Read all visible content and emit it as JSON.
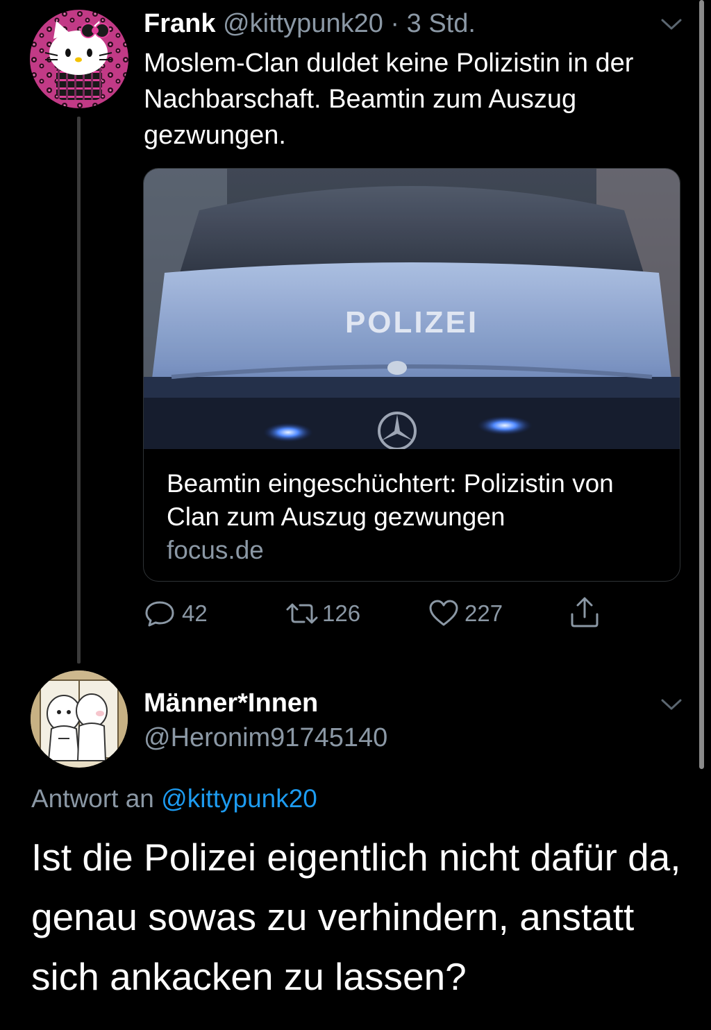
{
  "tweet": {
    "name": "Frank",
    "handle": "@kittypunk20",
    "separator": "·",
    "time": "3 Std.",
    "text": "Moslem-Clan duldet keine Polizistin in der Nachbarschaft. Beamtin zum Auszug gezwungen.",
    "avatar_icon": "hello-kitty-avatar",
    "card": {
      "image_text": "POLIZEI",
      "title": "Beamtin eingeschüchtert: Polizistin von Clan zum Auszug gezwungen",
      "domain": "focus.de"
    },
    "actions": {
      "replies": "42",
      "retweets": "126",
      "likes": "227",
      "reply_icon": "reply-icon",
      "retweet_icon": "retweet-icon",
      "like_icon": "heart-icon",
      "share_icon": "share-icon"
    }
  },
  "reply": {
    "name": "Männer*Innen",
    "handle": "@Heronim91745140",
    "reply_to_label": "Antwort an",
    "reply_to_handle": "@kittypunk20",
    "text": "Ist die Polizei eigentlich nicht dafür da, genau sowas zu verhindern, anstatt sich ankacken zu lassen?",
    "avatar_icon": "cartoon-avatar"
  },
  "colors": {
    "background": "#000000",
    "text": "#ffffff",
    "secondary": "#8b98a5",
    "link": "#1d9bf0",
    "divider": "#2f3336"
  }
}
